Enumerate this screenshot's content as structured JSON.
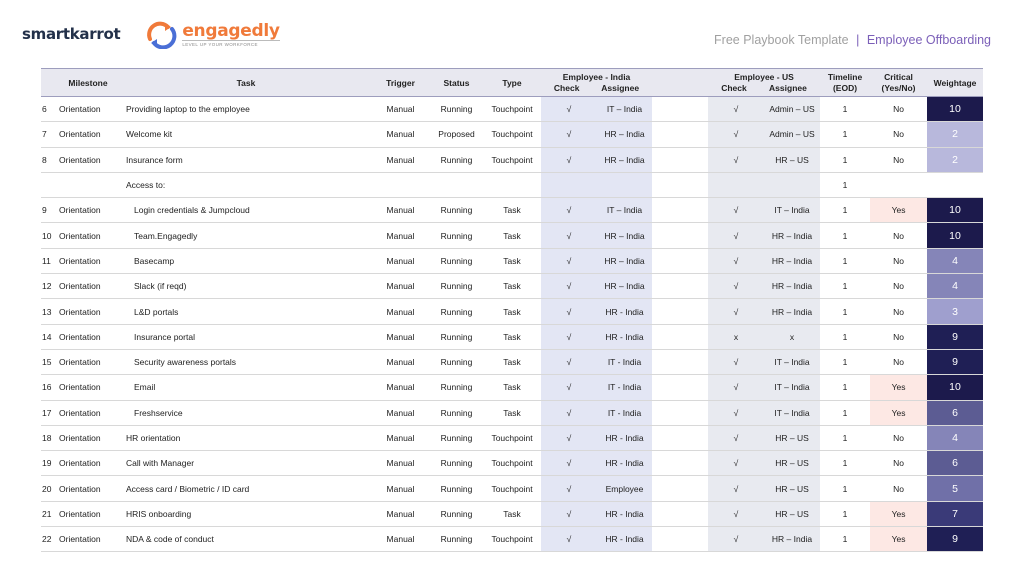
{
  "brand": {
    "primary_logo": "smartkarrot",
    "secondary_logo": "engagedly",
    "secondary_tagline": "LEVEL UP YOUR WORKFORCE"
  },
  "header": {
    "title": "Free Playbook Template",
    "separator": "|",
    "subtitle": "Employee Offboarding"
  },
  "colors": {
    "accent": "#7b5fb8",
    "header_bg": "#e8e8f0",
    "india_bg": "#e3e6f4",
    "yes_bg": "#fde8e4",
    "weight_dark": "#1c1a4c",
    "weight_light": "#b8b8dc"
  },
  "table": {
    "columns": {
      "milestone": "Milestone",
      "task": "Task",
      "trigger": "Trigger",
      "status": "Status",
      "type": "Type",
      "india_group": "Employee - India",
      "india_check": "Check",
      "india_assignee": "Assignee",
      "us_group": "Employee - US",
      "us_check": "Check",
      "us_assignee": "Assignee",
      "timeline": "Timeline",
      "timeline_unit": "(EOD)",
      "critical": "Critical",
      "critical_unit": "(Yes/No)",
      "weightage": "Weightage"
    },
    "rows": [
      {
        "num": "6",
        "milestone": "Orientation",
        "task": "Providing laptop to the employee",
        "indent": false,
        "trigger": "Manual",
        "status": "Running",
        "type": "Touchpoint",
        "india_check": "√",
        "india_assignee": "IT – India",
        "us_check": "√",
        "us_assignee": "Admin – US",
        "timeline": "1",
        "critical": "No",
        "weightage": "10"
      },
      {
        "num": "7",
        "milestone": "Orientation",
        "task": "Welcome kit",
        "indent": false,
        "trigger": "Manual",
        "status": "Proposed",
        "type": "Touchpoint",
        "india_check": "√",
        "india_assignee": "HR – India",
        "us_check": "√",
        "us_assignee": "Admin – US",
        "timeline": "1",
        "critical": "No",
        "weightage": "2"
      },
      {
        "num": "8",
        "milestone": "Orientation",
        "task": "Insurance form",
        "indent": false,
        "trigger": "Manual",
        "status": "Running",
        "type": "Touchpoint",
        "india_check": "√",
        "india_assignee": "HR – India",
        "us_check": "√",
        "us_assignee": "HR – US",
        "timeline": "1",
        "critical": "No",
        "weightage": "2"
      },
      {
        "num": "",
        "milestone": "",
        "task": "Access to:",
        "indent": false,
        "trigger": "",
        "status": "",
        "type": "",
        "india_check": "",
        "india_assignee": "",
        "us_check": "",
        "us_assignee": "",
        "timeline": "1",
        "critical": "",
        "weightage": ""
      },
      {
        "num": "9",
        "milestone": "Orientation",
        "task": "Login credentials & Jumpcloud",
        "indent": true,
        "trigger": "Manual",
        "status": "Running",
        "type": "Task",
        "india_check": "√",
        "india_assignee": "IT – India",
        "us_check": "√",
        "us_assignee": "IT – India",
        "timeline": "1",
        "critical": "Yes",
        "weightage": "10"
      },
      {
        "num": "10",
        "milestone": "Orientation",
        "task": "Team.Engagedly",
        "indent": true,
        "trigger": "Manual",
        "status": "Running",
        "type": "Task",
        "india_check": "√",
        "india_assignee": "HR – India",
        "us_check": "√",
        "us_assignee": "HR – India",
        "timeline": "1",
        "critical": "No",
        "weightage": "10"
      },
      {
        "num": "11",
        "milestone": "Orientation",
        "task": "Basecamp",
        "indent": true,
        "trigger": "Manual",
        "status": "Running",
        "type": "Task",
        "india_check": "√",
        "india_assignee": "HR – India",
        "us_check": "√",
        "us_assignee": "HR – India",
        "timeline": "1",
        "critical": "No",
        "weightage": "4"
      },
      {
        "num": "12",
        "milestone": "Orientation",
        "task": "Slack (if reqd)",
        "indent": true,
        "trigger": "Manual",
        "status": "Running",
        "type": "Task",
        "india_check": "√",
        "india_assignee": "HR – India",
        "us_check": "√",
        "us_assignee": "HR – India",
        "timeline": "1",
        "critical": "No",
        "weightage": "4"
      },
      {
        "num": "13",
        "milestone": "Orientation",
        "task": "L&D portals",
        "indent": true,
        "trigger": "Manual",
        "status": "Running",
        "type": "Task",
        "india_check": "√",
        "india_assignee": "HR - India",
        "us_check": "√",
        "us_assignee": "HR – India",
        "timeline": "1",
        "critical": "No",
        "weightage": "3"
      },
      {
        "num": "14",
        "milestone": "Orientation",
        "task": "Insurance portal",
        "indent": true,
        "trigger": "Manual",
        "status": "Running",
        "type": "Task",
        "india_check": "√",
        "india_assignee": "HR - India",
        "us_check": "x",
        "us_assignee": "x",
        "timeline": "1",
        "critical": "No",
        "weightage": "9"
      },
      {
        "num": "15",
        "milestone": "Orientation",
        "task": "Security awareness portals",
        "indent": true,
        "trigger": "Manual",
        "status": "Running",
        "type": "Task",
        "india_check": "√",
        "india_assignee": "IT - India",
        "us_check": "√",
        "us_assignee": "IT – India",
        "timeline": "1",
        "critical": "No",
        "weightage": "9"
      },
      {
        "num": "16",
        "milestone": "Orientation",
        "task": "Email",
        "indent": true,
        "trigger": "Manual",
        "status": "Running",
        "type": "Task",
        "india_check": "√",
        "india_assignee": "IT - India",
        "us_check": "√",
        "us_assignee": "IT – India",
        "timeline": "1",
        "critical": "Yes",
        "weightage": "10"
      },
      {
        "num": "17",
        "milestone": "Orientation",
        "task": "Freshservice",
        "indent": true,
        "trigger": "Manual",
        "status": "Running",
        "type": "Task",
        "india_check": "√",
        "india_assignee": "IT - India",
        "us_check": "√",
        "us_assignee": "IT – India",
        "timeline": "1",
        "critical": "Yes",
        "weightage": "6"
      },
      {
        "num": "18",
        "milestone": "Orientation",
        "task": "HR orientation",
        "indent": false,
        "trigger": "Manual",
        "status": "Running",
        "type": "Touchpoint",
        "india_check": "√",
        "india_assignee": "HR - India",
        "us_check": "√",
        "us_assignee": "HR – US",
        "timeline": "1",
        "critical": "No",
        "weightage": "4"
      },
      {
        "num": "19",
        "milestone": "Orientation",
        "task": "Call with Manager",
        "indent": false,
        "trigger": "Manual",
        "status": "Running",
        "type": "Touchpoint",
        "india_check": "√",
        "india_assignee": "HR - India",
        "us_check": "√",
        "us_assignee": "HR – US",
        "timeline": "1",
        "critical": "No",
        "weightage": "6"
      },
      {
        "num": "20",
        "milestone": "Orientation",
        "task": "Access card / Biometric / ID card",
        "indent": false,
        "trigger": "Manual",
        "status": "Running",
        "type": "Touchpoint",
        "india_check": "√",
        "india_assignee": "Employee",
        "us_check": "√",
        "us_assignee": "HR – US",
        "timeline": "1",
        "critical": "No",
        "weightage": "5"
      },
      {
        "num": "21",
        "milestone": "Orientation",
        "task": "HRIS onboarding",
        "indent": false,
        "trigger": "Manual",
        "status": "Running",
        "type": "Task",
        "india_check": "√",
        "india_assignee": "HR - India",
        "us_check": "√",
        "us_assignee": "HR – US",
        "timeline": "1",
        "critical": "Yes",
        "weightage": "7"
      },
      {
        "num": "22",
        "milestone": "Orientation",
        "task": "NDA & code of conduct",
        "indent": false,
        "trigger": "Manual",
        "status": "Running",
        "type": "Touchpoint",
        "india_check": "√",
        "india_assignee": "HR - India",
        "us_check": "√",
        "us_assignee": "HR – India",
        "timeline": "1",
        "critical": "Yes",
        "weightage": "9"
      }
    ]
  }
}
